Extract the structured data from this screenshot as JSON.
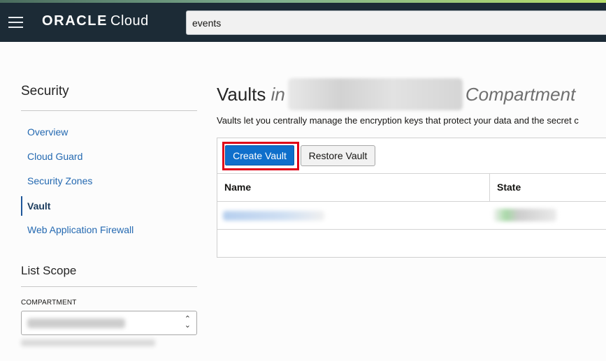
{
  "header": {
    "brand": "ORACLE",
    "product": "Cloud",
    "search_value": "events"
  },
  "sidebar": {
    "title": "Security",
    "items": [
      {
        "label": "Overview",
        "active": false
      },
      {
        "label": "Cloud Guard",
        "active": false
      },
      {
        "label": "Security Zones",
        "active": false
      },
      {
        "label": "Vault",
        "active": true
      },
      {
        "label": "Web Application Firewall",
        "active": false
      }
    ],
    "scope_title": "List Scope",
    "compartment_label": "COMPARTMENT"
  },
  "main": {
    "title_prefix": "Vaults",
    "title_in": "in",
    "title_suffix": "Compartment",
    "description": "Vaults let you centrally manage the encryption keys that protect your data and the secret c",
    "buttons": {
      "create": "Create Vault",
      "restore": "Restore Vault"
    },
    "table": {
      "columns": [
        "Name",
        "State"
      ]
    }
  },
  "colors": {
    "topbar": "#1c2b36",
    "primary_button": "#0f6fcb",
    "link": "#2469b1",
    "highlight_box": "#e00016"
  },
  "icons": [
    "hamburger-menu-icon",
    "select-chevron-icon"
  ]
}
